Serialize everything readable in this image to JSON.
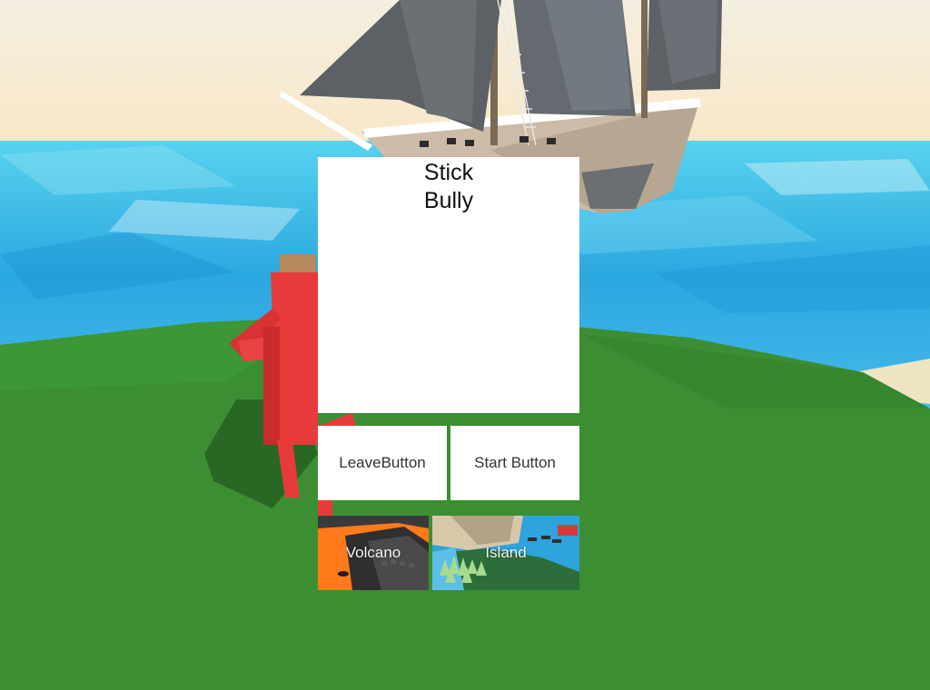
{
  "panel": {
    "title_line1": "Stick",
    "title_line2": "Bully"
  },
  "buttons": {
    "leave_label": "LeaveButton",
    "start_label": "Start Button"
  },
  "maps": [
    {
      "label": "Volcano"
    },
    {
      "label": "Island"
    }
  ],
  "colors": {
    "sky": "#f7eed7",
    "sea": "#39b8e6",
    "grass": "#3b8f32",
    "character": "#e73b3b",
    "sail": "#5c6166",
    "hull": "#c3b3a0"
  }
}
